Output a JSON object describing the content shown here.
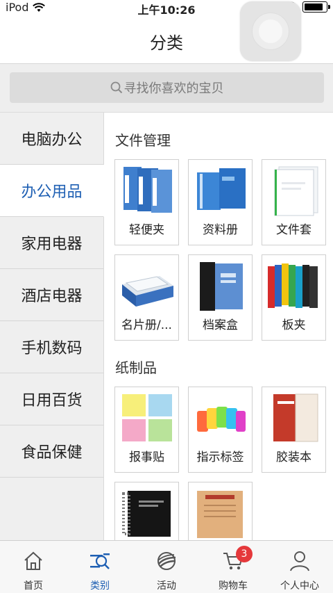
{
  "status_bar": {
    "carrier": "iPod",
    "time": "上午10:26",
    "battery_level": 0.85
  },
  "nav": {
    "title": "分类"
  },
  "search": {
    "placeholder": "寻找你喜欢的宝贝"
  },
  "sidebar": {
    "items": [
      {
        "label": "电脑办公",
        "active": false
      },
      {
        "label": "办公用品",
        "active": true
      },
      {
        "label": "家用电器",
        "active": false
      },
      {
        "label": "酒店电器",
        "active": false
      },
      {
        "label": "手机数码",
        "active": false
      },
      {
        "label": "日用百货",
        "active": false
      },
      {
        "label": "食品保健",
        "active": false
      }
    ]
  },
  "content": {
    "sections": [
      {
        "title": "文件管理",
        "items": [
          {
            "label": "轻便夹",
            "icon": "binder-folders-image"
          },
          {
            "label": "资料册",
            "icon": "display-book-image"
          },
          {
            "label": "文件套",
            "icon": "file-sleeve-image"
          },
          {
            "label": "名片册/...",
            "icon": "card-box-image"
          },
          {
            "label": "档案盒",
            "icon": "archive-box-image"
          },
          {
            "label": "板夹",
            "icon": "clipboard-folders-image"
          }
        ]
      },
      {
        "title": "纸制品",
        "items": [
          {
            "label": "报事贴",
            "icon": "sticky-notes-image"
          },
          {
            "label": "指示标签",
            "icon": "index-tabs-image"
          },
          {
            "label": "胶装本",
            "icon": "bound-notebook-image"
          },
          {
            "label": "",
            "icon": "spiral-notebook-image"
          },
          {
            "label": "",
            "icon": "archive-envelope-image"
          }
        ]
      }
    ]
  },
  "tabbar": {
    "tabs": [
      {
        "label": "首页",
        "icon": "home-icon"
      },
      {
        "label": "类别",
        "icon": "category-list-icon",
        "active": true
      },
      {
        "label": "活动",
        "icon": "activity-globe-icon"
      },
      {
        "label": "购物车",
        "icon": "cart-icon",
        "badge": "3"
      },
      {
        "label": "个人中心",
        "icon": "person-icon"
      }
    ]
  },
  "colors": {
    "accent": "#1e5fb3",
    "badge": "#e5383b"
  }
}
